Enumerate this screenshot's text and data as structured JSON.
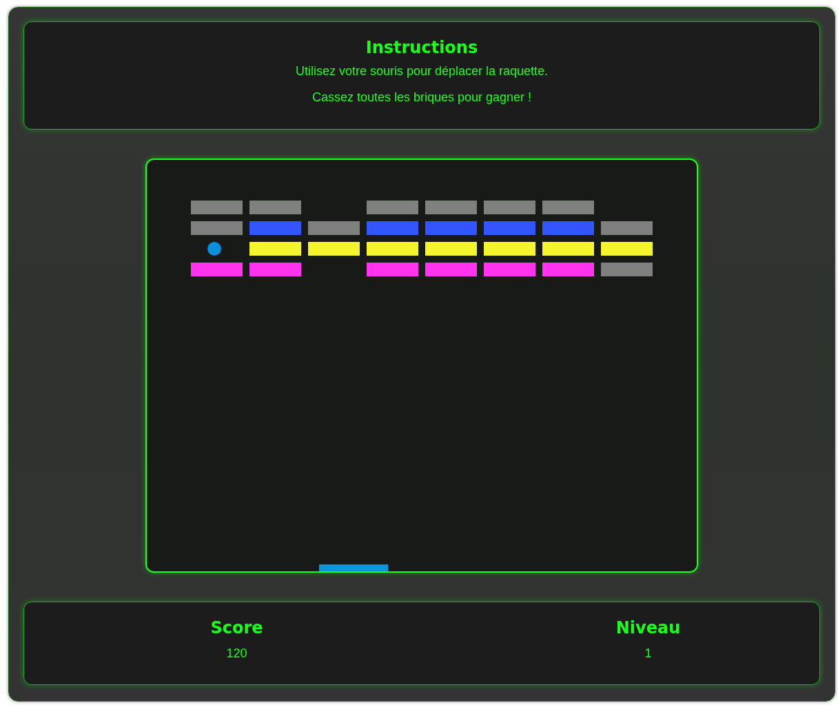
{
  "instructions": {
    "title": "Instructions",
    "lines": [
      "Utilisez votre souris pour déplacer la raquette.",
      "Cassez toutes les briques pour gagner !"
    ]
  },
  "board": {
    "brick_rows": [
      [
        {
          "kind": "brick",
          "color": "#808080"
        },
        {
          "kind": "brick",
          "color": "#808080"
        },
        {
          "kind": "empty"
        },
        {
          "kind": "brick",
          "color": "#808080"
        },
        {
          "kind": "brick",
          "color": "#808080"
        },
        {
          "kind": "brick",
          "color": "#808080"
        },
        {
          "kind": "brick",
          "color": "#808080"
        },
        {
          "kind": "empty"
        }
      ],
      [
        {
          "kind": "brick",
          "color": "#808080"
        },
        {
          "kind": "brick",
          "color": "#3355ff"
        },
        {
          "kind": "brick",
          "color": "#808080"
        },
        {
          "kind": "brick",
          "color": "#3355ff"
        },
        {
          "kind": "brick",
          "color": "#3355ff"
        },
        {
          "kind": "brick",
          "color": "#3355ff"
        },
        {
          "kind": "brick",
          "color": "#3355ff"
        },
        {
          "kind": "brick",
          "color": "#808080"
        }
      ],
      [
        {
          "kind": "empty"
        },
        {
          "kind": "brick",
          "color": "#f5f52e"
        },
        {
          "kind": "brick",
          "color": "#f5f52e"
        },
        {
          "kind": "brick",
          "color": "#f5f52e"
        },
        {
          "kind": "brick",
          "color": "#f5f52e"
        },
        {
          "kind": "brick",
          "color": "#f5f52e"
        },
        {
          "kind": "brick",
          "color": "#f5f52e"
        },
        {
          "kind": "brick",
          "color": "#f5f52e"
        }
      ],
      [
        {
          "kind": "brick",
          "color": "#ff33ee"
        },
        {
          "kind": "brick",
          "color": "#ff33ee"
        },
        {
          "kind": "empty"
        },
        {
          "kind": "brick",
          "color": "#ff33ee"
        },
        {
          "kind": "brick",
          "color": "#ff33ee"
        },
        {
          "kind": "brick",
          "color": "#ff33ee"
        },
        {
          "kind": "brick",
          "color": "#ff33ee"
        },
        {
          "kind": "brick",
          "color": "#808080"
        }
      ]
    ]
  },
  "stats": [
    {
      "label": "Score",
      "value": "120"
    },
    {
      "label": "Niveau",
      "value": "1"
    }
  ]
}
